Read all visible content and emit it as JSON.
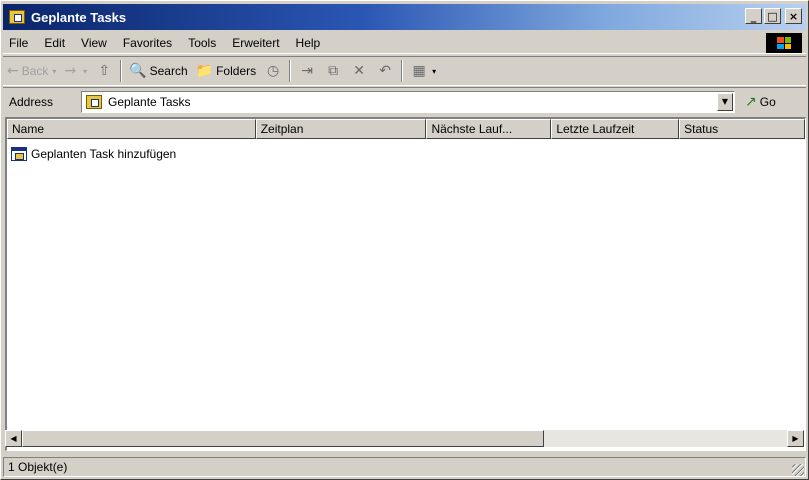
{
  "window": {
    "title": "Geplante Tasks",
    "controls": {
      "minimize": "_",
      "maximize": "□",
      "close": "×"
    }
  },
  "menubar": {
    "items": [
      {
        "label": "File"
      },
      {
        "label": "Edit"
      },
      {
        "label": "View"
      },
      {
        "label": "Favorites"
      },
      {
        "label": "Tools"
      },
      {
        "label": "Erweitert"
      },
      {
        "label": "Help"
      }
    ]
  },
  "toolbar": {
    "back_label": "Back",
    "search_label": "Search",
    "folders_label": "Folders",
    "back_icon": "←",
    "forward_icon": "→",
    "up_icon": "⇧",
    "search_icon": "🔍",
    "folders_icon": "📁",
    "history_icon": "◷",
    "moveto_icon": "⇥",
    "copyto_icon": "⧉",
    "delete_icon": "✕",
    "undo_icon": "↶",
    "views_icon": "▦",
    "dropdown_icon": "▾"
  },
  "addressbar": {
    "label": "Address",
    "value": "Geplante Tasks",
    "go_label": "Go",
    "go_icon": "↗",
    "dropdown_icon": "▼"
  },
  "listview": {
    "columns": [
      {
        "label": "Name"
      },
      {
        "label": "Zeitplan"
      },
      {
        "label": "Nächste Lauf..."
      },
      {
        "label": "Letzte Laufzeit"
      },
      {
        "label": "Status"
      }
    ],
    "rows": [
      {
        "name": "Geplanten Task hinzufügen"
      }
    ]
  },
  "scrollbar": {
    "left_icon": "◀",
    "right_icon": "▶"
  },
  "statusbar": {
    "text": "1 Objekt(e)"
  }
}
